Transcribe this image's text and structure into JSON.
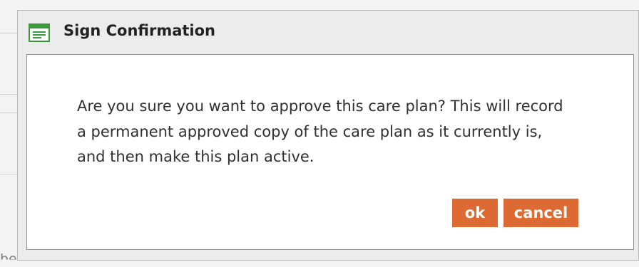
{
  "background": {
    "partial_text": "ber and/or caregiver."
  },
  "dialog": {
    "title": "Sign Confirmation",
    "icon": "document-list-icon",
    "message": "Are you sure you want to approve this care plan? This will record a permanent approved copy of the care plan as it currently is, and then make this plan active.",
    "buttons": {
      "ok_label": "ok",
      "cancel_label": "cancel"
    }
  },
  "colors": {
    "accent": "#dd6a32",
    "icon_green": "#3a9a3a"
  }
}
